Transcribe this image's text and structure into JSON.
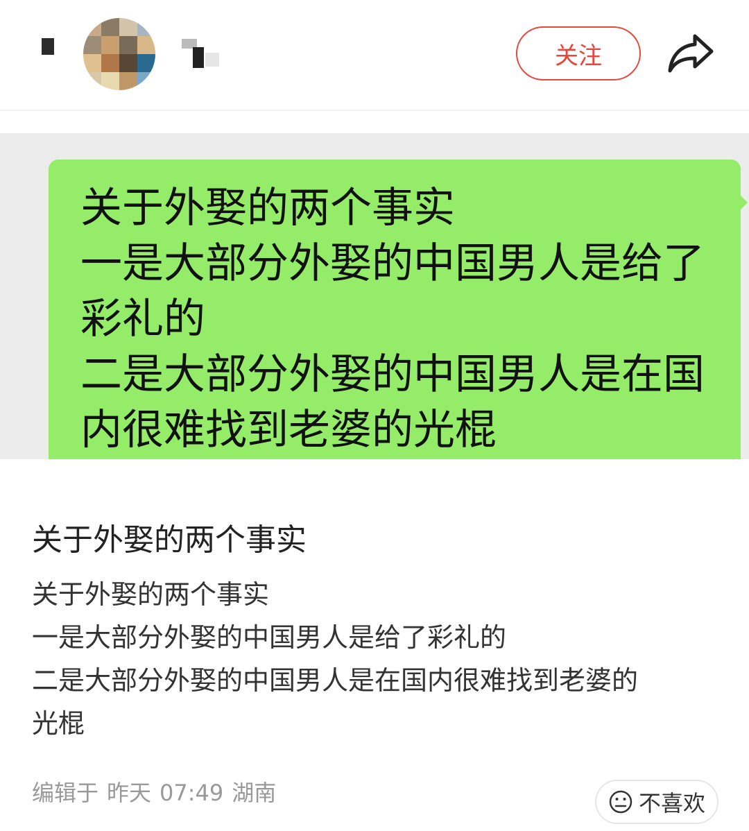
{
  "header": {
    "follow_label": "关注"
  },
  "image": {
    "bubble_lines": [
      "关于外娶的两个事实",
      "一是大部分外娶的中国男人是给了",
      "彩礼的",
      "二是大部分外娶的中国男人是在国",
      "内很难找到老婆的光棍"
    ],
    "bubble_color": "#95ec69"
  },
  "post": {
    "title": "关于外娶的两个事实",
    "body_lines": [
      "关于外娶的两个事实",
      "一是大部分外娶的中国男人是给了彩礼的",
      "二是大部分外娶的中国男人是在国内很难找到老婆的",
      "光棍"
    ]
  },
  "footer": {
    "edited_prefix": "编辑于",
    "edited_day": "昨天",
    "edited_time": "07:49",
    "location": "湖南",
    "dislike_label": "不喜欢"
  },
  "colors": {
    "accent": "#e8453c"
  },
  "icons": {
    "share": "share-icon",
    "dislike": "neutral-face-icon",
    "back": "back-icon"
  }
}
